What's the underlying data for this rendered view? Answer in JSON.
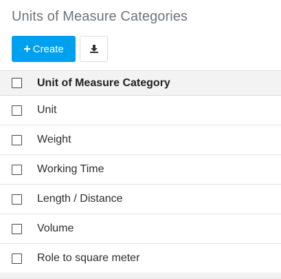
{
  "page": {
    "title": "Units of Measure Categories"
  },
  "toolbar": {
    "create_label": "Create",
    "create_icon": "plus-icon",
    "download_icon": "download-icon",
    "accent_color": "#00a0f0"
  },
  "table": {
    "header": "Unit of Measure Category",
    "rows": [
      "Unit",
      "Weight",
      "Working Time",
      "Length / Distance",
      "Volume",
      "Role to square meter"
    ]
  }
}
